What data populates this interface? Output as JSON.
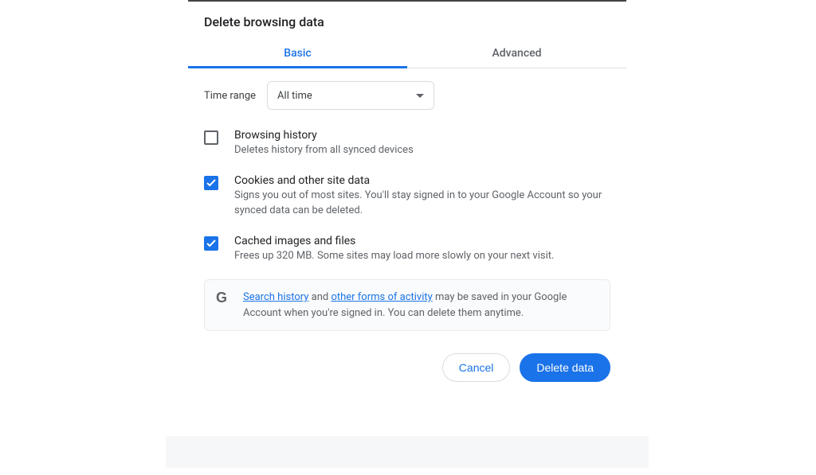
{
  "dialog": {
    "title": "Delete browsing data",
    "tabs": {
      "basic": "Basic",
      "advanced": "Advanced",
      "active": "basic"
    },
    "time": {
      "label": "Time range",
      "value": "All time"
    },
    "options": {
      "browsing_history": {
        "checked": false,
        "title": "Browsing history",
        "desc": "Deletes history from all synced devices"
      },
      "cookies": {
        "checked": true,
        "title": "Cookies and other site data",
        "desc": "Signs you out of most sites. You'll stay signed in to your Google Account so your synced data can be deleted."
      },
      "cache": {
        "checked": true,
        "title": "Cached images and files",
        "desc": "Frees up 320 MB. Some sites may load more slowly on your next visit."
      }
    },
    "info": {
      "link1": "Search history",
      "mid1": " and ",
      "link2": "other forms of activity",
      "rest": " may be saved in your Google Account when you're signed in. You can delete them anytime."
    },
    "buttons": {
      "cancel": "Cancel",
      "confirm": "Delete data"
    }
  }
}
